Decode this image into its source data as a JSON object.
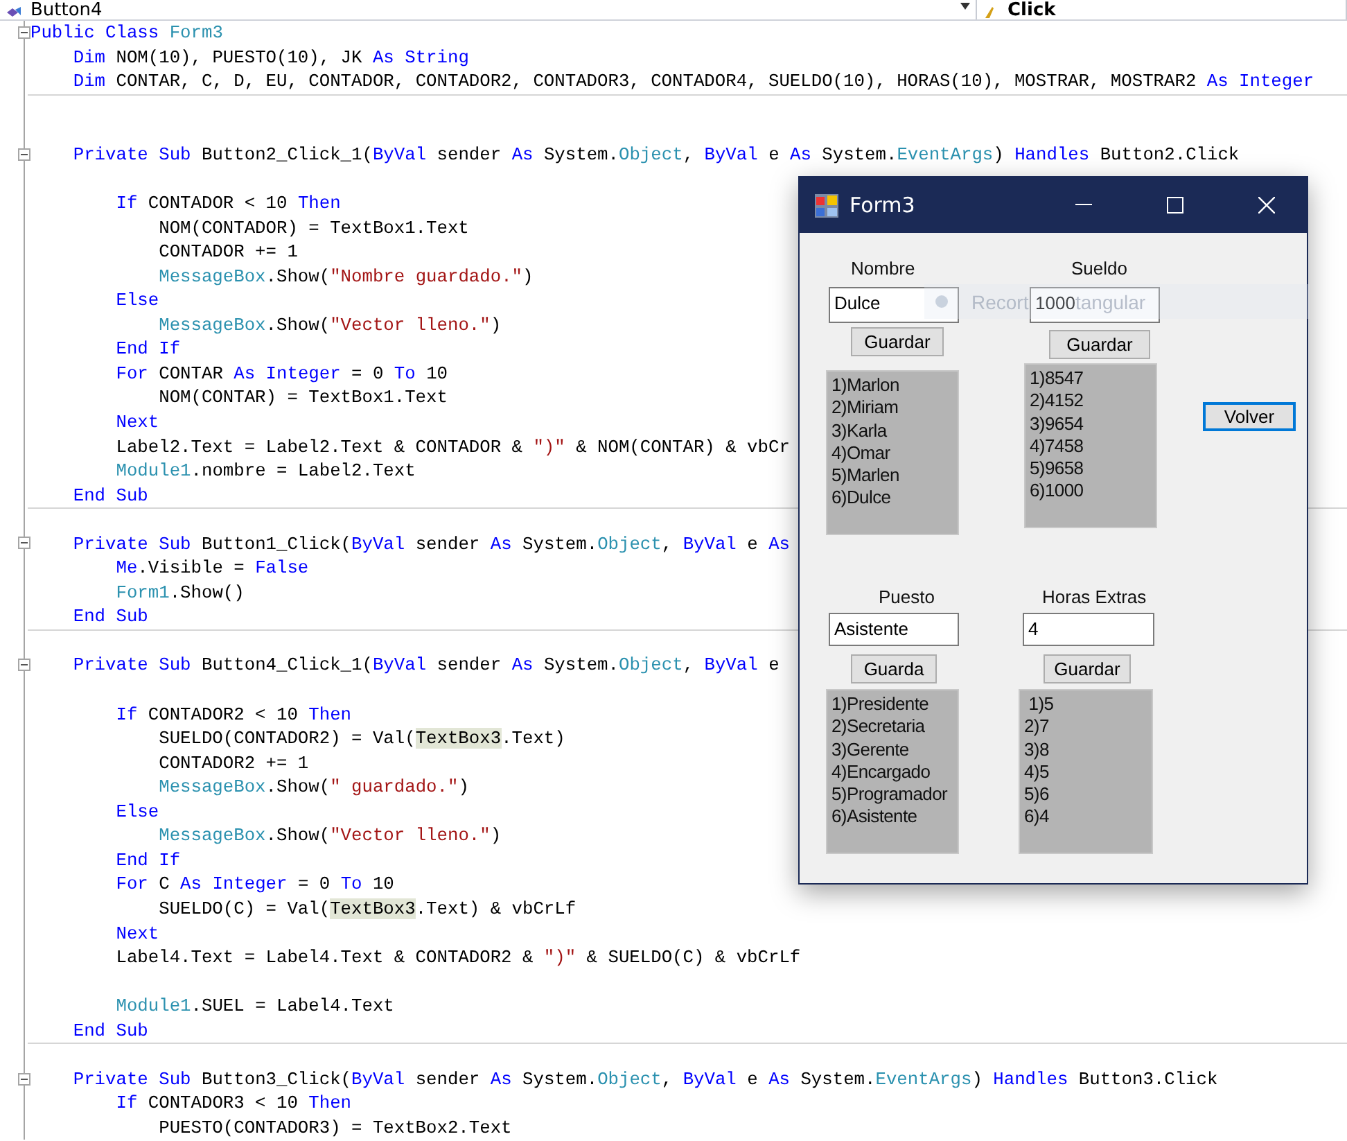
{
  "nav_bar": {
    "member": "Button4",
    "event": "Click"
  },
  "code_lines": [
    {
      "kind": "code",
      "fold": true,
      "tokens": [
        {
          "text": "Public Class ",
          "kind": "kw"
        },
        {
          "text": "Form3",
          "kind": "type"
        }
      ]
    },
    {
      "kind": "code",
      "tokens": [
        {
          "text": "    Dim ",
          "kind": "kw"
        },
        {
          "text": "NOM(10), PUESTO(10), JK ",
          "kind": "plain"
        },
        {
          "text": "As String",
          "kind": "kw"
        }
      ]
    },
    {
      "kind": "code",
      "tokens": [
        {
          "text": "    Dim ",
          "kind": "kw"
        },
        {
          "text": "CONTAR, C, D, EU, CONTADOR, CONTADOR2, CONTADOR3, CONTADOR4, SUELDO(10), HORAS(10), MOSTRAR, MOSTRAR2 ",
          "kind": "plain"
        },
        {
          "text": "As Integer",
          "kind": "kw"
        }
      ]
    },
    {
      "kind": "blank",
      "divider": true
    },
    {
      "kind": "blank"
    },
    {
      "kind": "code",
      "fold": true,
      "tokens": [
        {
          "text": "    Private Sub ",
          "kind": "kw"
        },
        {
          "text": "Button2_Click_1(",
          "kind": "plain"
        },
        {
          "text": "ByVal ",
          "kind": "kw"
        },
        {
          "text": "sender ",
          "kind": "plain"
        },
        {
          "text": "As ",
          "kind": "kw"
        },
        {
          "text": "System.",
          "kind": "plain"
        },
        {
          "text": "Object",
          "kind": "type"
        },
        {
          "text": ", ",
          "kind": "plain"
        },
        {
          "text": "ByVal ",
          "kind": "kw"
        },
        {
          "text": "e ",
          "kind": "plain"
        },
        {
          "text": "As ",
          "kind": "kw"
        },
        {
          "text": "System.",
          "kind": "plain"
        },
        {
          "text": "EventArgs",
          "kind": "type"
        },
        {
          "text": ") ",
          "kind": "plain"
        },
        {
          "text": "Handles ",
          "kind": "kw"
        },
        {
          "text": "Button2.Click",
          "kind": "plain"
        }
      ]
    },
    {
      "kind": "blank"
    },
    {
      "kind": "code",
      "tokens": [
        {
          "text": "        If ",
          "kind": "kw"
        },
        {
          "text": "CONTADOR < 10 ",
          "kind": "plain"
        },
        {
          "text": "Then",
          "kind": "kw"
        }
      ]
    },
    {
      "kind": "code",
      "tokens": [
        {
          "text": "            NOM(CONTADOR) = TextBox1.Text",
          "kind": "plain"
        }
      ]
    },
    {
      "kind": "code",
      "tokens": [
        {
          "text": "            CONTADOR += 1",
          "kind": "plain"
        }
      ]
    },
    {
      "kind": "code",
      "tokens": [
        {
          "text": "            MessageBox",
          "kind": "type"
        },
        {
          "text": ".Show(",
          "kind": "plain"
        },
        {
          "text": "\"Nombre guardado.\"",
          "kind": "str"
        },
        {
          "text": ")",
          "kind": "plain"
        }
      ]
    },
    {
      "kind": "code",
      "tokens": [
        {
          "text": "        Else",
          "kind": "kw"
        }
      ]
    },
    {
      "kind": "code",
      "tokens": [
        {
          "text": "            MessageBox",
          "kind": "type"
        },
        {
          "text": ".Show(",
          "kind": "plain"
        },
        {
          "text": "\"Vector lleno.\"",
          "kind": "str"
        },
        {
          "text": ")",
          "kind": "plain"
        }
      ]
    },
    {
      "kind": "code",
      "tokens": [
        {
          "text": "        End If",
          "kind": "kw"
        }
      ]
    },
    {
      "kind": "code",
      "tokens": [
        {
          "text": "        For ",
          "kind": "kw"
        },
        {
          "text": "CONTAR ",
          "kind": "plain"
        },
        {
          "text": "As Integer ",
          "kind": "kw"
        },
        {
          "text": "= 0 ",
          "kind": "plain"
        },
        {
          "text": "To ",
          "kind": "kw"
        },
        {
          "text": "10",
          "kind": "plain"
        }
      ]
    },
    {
      "kind": "code",
      "tokens": [
        {
          "text": "            NOM(CONTAR) = TextBox1.Text",
          "kind": "plain"
        }
      ]
    },
    {
      "kind": "code",
      "tokens": [
        {
          "text": "        Next",
          "kind": "kw"
        }
      ]
    },
    {
      "kind": "code",
      "tokens": [
        {
          "text": "        Label2.Text = Label2.Text & CONTADOR & ",
          "kind": "plain"
        },
        {
          "text": "\")\"",
          "kind": "str"
        },
        {
          "text": " & NOM(CONTAR) & vbCr",
          "kind": "plain"
        }
      ]
    },
    {
      "kind": "code",
      "tokens": [
        {
          "text": "        Module1",
          "kind": "type"
        },
        {
          "text": ".nombre = Label2.Text",
          "kind": "plain"
        }
      ]
    },
    {
      "kind": "code",
      "tokens": [
        {
          "text": "    End Sub",
          "kind": "kw"
        }
      ]
    },
    {
      "kind": "blank",
      "divider": true
    },
    {
      "kind": "code",
      "fold": true,
      "tokens": [
        {
          "text": "    Private Sub ",
          "kind": "kw"
        },
        {
          "text": "Button1_Click(",
          "kind": "plain"
        },
        {
          "text": "ByVal ",
          "kind": "kw"
        },
        {
          "text": "sender ",
          "kind": "plain"
        },
        {
          "text": "As ",
          "kind": "kw"
        },
        {
          "text": "System.",
          "kind": "plain"
        },
        {
          "text": "Object",
          "kind": "type"
        },
        {
          "text": ", ",
          "kind": "plain"
        },
        {
          "text": "ByVal ",
          "kind": "kw"
        },
        {
          "text": "e ",
          "kind": "plain"
        },
        {
          "text": "As",
          "kind": "kw"
        }
      ]
    },
    {
      "kind": "code",
      "tokens": [
        {
          "text": "        Me",
          "kind": "kw"
        },
        {
          "text": ".Visible = ",
          "kind": "plain"
        },
        {
          "text": "False",
          "kind": "kw"
        }
      ]
    },
    {
      "kind": "code",
      "tokens": [
        {
          "text": "        Form1",
          "kind": "type"
        },
        {
          "text": ".Show()",
          "kind": "plain"
        }
      ]
    },
    {
      "kind": "code",
      "tokens": [
        {
          "text": "    End Sub",
          "kind": "kw"
        }
      ]
    },
    {
      "kind": "blank",
      "divider": true
    },
    {
      "kind": "code",
      "fold": true,
      "tokens": [
        {
          "text": "    Private Sub ",
          "kind": "kw"
        },
        {
          "text": "Button4_Click_1(",
          "kind": "plain"
        },
        {
          "text": "ByVal ",
          "kind": "kw"
        },
        {
          "text": "sender ",
          "kind": "plain"
        },
        {
          "text": "As ",
          "kind": "kw"
        },
        {
          "text": "System.",
          "kind": "plain"
        },
        {
          "text": "Object",
          "kind": "type"
        },
        {
          "text": ", ",
          "kind": "plain"
        },
        {
          "text": "ByVal ",
          "kind": "kw"
        },
        {
          "text": "e",
          "kind": "plain"
        }
      ]
    },
    {
      "kind": "blank"
    },
    {
      "kind": "code",
      "tokens": [
        {
          "text": "        If ",
          "kind": "kw"
        },
        {
          "text": "CONTADOR2 < 10 ",
          "kind": "plain"
        },
        {
          "text": "Then",
          "kind": "kw"
        }
      ]
    },
    {
      "kind": "code",
      "tokens": [
        {
          "text": "            SUELDO(CONTADOR2) = Val(",
          "kind": "plain"
        },
        {
          "text": "TextBox3",
          "kind": "highlight"
        },
        {
          "text": ".Text)",
          "kind": "plain"
        }
      ]
    },
    {
      "kind": "code",
      "tokens": [
        {
          "text": "            CONTADOR2 += 1",
          "kind": "plain"
        }
      ]
    },
    {
      "kind": "code",
      "tokens": [
        {
          "text": "            MessageBox",
          "kind": "type"
        },
        {
          "text": ".Show(",
          "kind": "plain"
        },
        {
          "text": "\" guardado.\"",
          "kind": "str"
        },
        {
          "text": ")",
          "kind": "plain"
        }
      ]
    },
    {
      "kind": "code",
      "tokens": [
        {
          "text": "        Else",
          "kind": "kw"
        }
      ]
    },
    {
      "kind": "code",
      "tokens": [
        {
          "text": "            MessageBox",
          "kind": "type"
        },
        {
          "text": ".Show(",
          "kind": "plain"
        },
        {
          "text": "\"Vector lleno.\"",
          "kind": "str"
        },
        {
          "text": ")",
          "kind": "plain"
        }
      ]
    },
    {
      "kind": "code",
      "tokens": [
        {
          "text": "        End If",
          "kind": "kw"
        }
      ]
    },
    {
      "kind": "code",
      "tokens": [
        {
          "text": "        For ",
          "kind": "kw"
        },
        {
          "text": "C ",
          "kind": "plain"
        },
        {
          "text": "As Integer ",
          "kind": "kw"
        },
        {
          "text": "= 0 ",
          "kind": "plain"
        },
        {
          "text": "To ",
          "kind": "kw"
        },
        {
          "text": "10",
          "kind": "plain"
        }
      ]
    },
    {
      "kind": "code",
      "tokens": [
        {
          "text": "            SUELDO(C) = Val(",
          "kind": "plain"
        },
        {
          "text": "TextBox3",
          "kind": "highlight"
        },
        {
          "text": ".Text) & vbCrLf",
          "kind": "plain"
        }
      ]
    },
    {
      "kind": "code",
      "tokens": [
        {
          "text": "        Next",
          "kind": "kw"
        }
      ]
    },
    {
      "kind": "code",
      "tokens": [
        {
          "text": "        Label4.Text = Label4.Text & CONTADOR2 & ",
          "kind": "plain"
        },
        {
          "text": "\")\"",
          "kind": "str"
        },
        {
          "text": " & SUELDO(C) & vbCrLf",
          "kind": "plain"
        }
      ]
    },
    {
      "kind": "blank"
    },
    {
      "kind": "code",
      "tokens": [
        {
          "text": "        Module1",
          "kind": "type"
        },
        {
          "text": ".SUEL = Label4.Text",
          "kind": "plain"
        }
      ]
    },
    {
      "kind": "code",
      "tokens": [
        {
          "text": "    End Sub",
          "kind": "kw"
        }
      ]
    },
    {
      "kind": "blank",
      "divider": true
    },
    {
      "kind": "code",
      "fold": true,
      "tokens": [
        {
          "text": "    Private Sub ",
          "kind": "kw"
        },
        {
          "text": "Button3_Click(",
          "kind": "plain"
        },
        {
          "text": "ByVal ",
          "kind": "kw"
        },
        {
          "text": "sender ",
          "kind": "plain"
        },
        {
          "text": "As ",
          "kind": "kw"
        },
        {
          "text": "System.",
          "kind": "plain"
        },
        {
          "text": "Object",
          "kind": "type"
        },
        {
          "text": ", ",
          "kind": "plain"
        },
        {
          "text": "ByVal ",
          "kind": "kw"
        },
        {
          "text": "e ",
          "kind": "plain"
        },
        {
          "text": "As ",
          "kind": "kw"
        },
        {
          "text": "System.",
          "kind": "plain"
        },
        {
          "text": "EventArgs",
          "kind": "type"
        },
        {
          "text": ") ",
          "kind": "plain"
        },
        {
          "text": "Handles ",
          "kind": "kw"
        },
        {
          "text": "Button3.Click",
          "kind": "plain"
        }
      ]
    },
    {
      "kind": "code",
      "tokens": [
        {
          "text": "        If ",
          "kind": "kw"
        },
        {
          "text": "CONTADOR3 < 10 ",
          "kind": "plain"
        },
        {
          "text": "Then",
          "kind": "kw"
        }
      ]
    },
    {
      "kind": "code",
      "tokens": [
        {
          "text": "            PUESTO(CONTADOR3) = TextBox2.Text",
          "kind": "plain"
        }
      ]
    }
  ],
  "form_window": {
    "title": "Form3",
    "groups": [
      {
        "label": "Nombre",
        "value": "Dulce",
        "button": "Guardar",
        "items": [
          "1)Marlon",
          "2)Miriam",
          "3)Karla",
          "4)Omar",
          "5)Marlen",
          "6)Dulce"
        ]
      },
      {
        "label": "Sueldo",
        "value": "1000",
        "button": "Guardar",
        "items": [
          "1)8547",
          "2)4152",
          "3)9654",
          "4)7458",
          "5)9658",
          "6)1000"
        ]
      },
      {
        "label": "Puesto",
        "value": "Asistente",
        "button": "Guarda",
        "items": [
          "1)Presidente",
          "2)Secretaria",
          "3)Gerente",
          "4)Encargado",
          "5)Programador",
          "6)Asistente"
        ]
      },
      {
        "label": "Horas Extras",
        "value": "4",
        "button": "Guardar",
        "items": [
          " 1)5",
          "2)7",
          "3)8",
          "4)5",
          "5)6",
          "6)4"
        ]
      }
    ],
    "back_button": {
      "label": "Volver",
      "focused": true
    }
  },
  "ghost_toolbar": {
    "text_start": "Recort",
    "text_end": "tangular"
  }
}
